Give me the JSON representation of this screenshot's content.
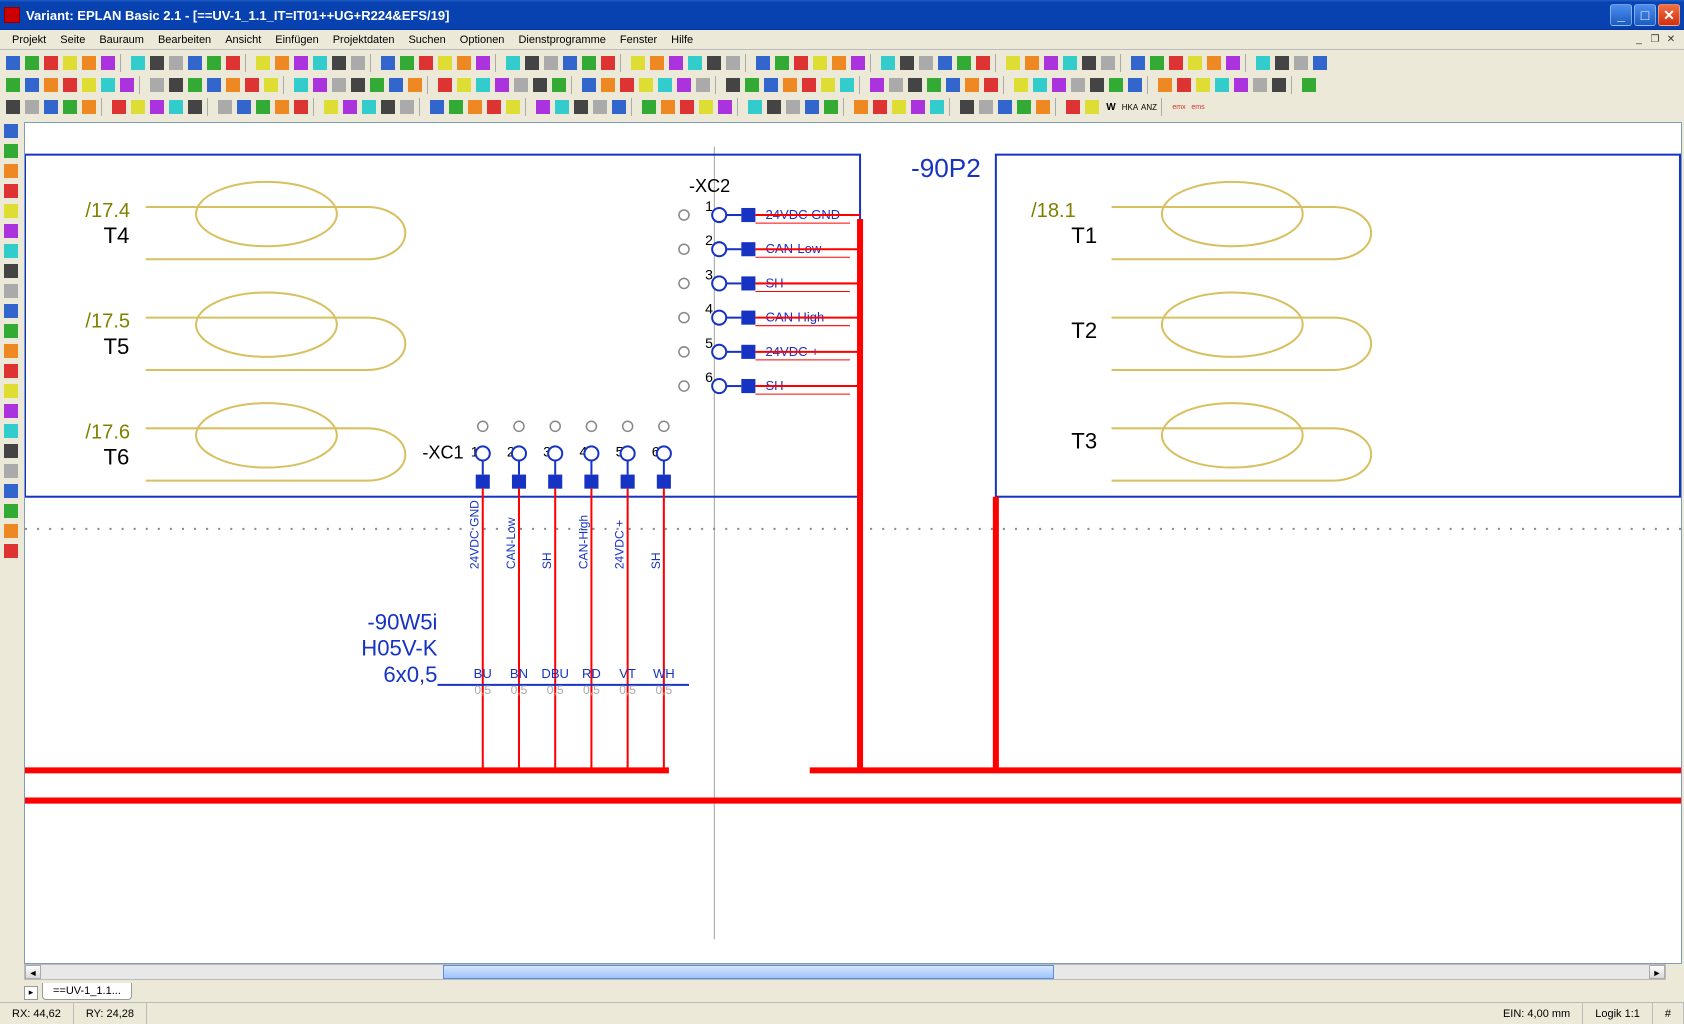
{
  "app": {
    "title": "Variant:  EPLAN Basic 2.1 - [==UV-1_1.1_IT=IT01++UG+R224&EFS/19]"
  },
  "menu": {
    "items": [
      "Projekt",
      "Seite",
      "Bauraum",
      "Bearbeiten",
      "Ansicht",
      "Einfügen",
      "Projektdaten",
      "Suchen",
      "Optionen",
      "Dienstprogramme",
      "Fenster",
      "Hilfe"
    ]
  },
  "schematic": {
    "part90P2": "-90P2",
    "connXC2": "-XC2",
    "connXC1": "-XC1",
    "xc2_pins": [
      "1",
      "2",
      "3",
      "4",
      "5",
      "6"
    ],
    "xc2_signals": [
      "24VDC GND",
      "CAN-Low",
      "SH",
      "CAN-High",
      "24VDC +",
      "SH"
    ],
    "xc1_pins": [
      "1",
      "2",
      "3",
      "4",
      "5",
      "6"
    ],
    "xc1_signals": [
      "24VDC GND",
      "CAN-Low",
      "SH",
      "CAN-High",
      "24VDC +",
      "SH"
    ],
    "leftrefs": [
      {
        "page": "/17.4",
        "term": "T4"
      },
      {
        "page": "/17.5",
        "term": "T5"
      },
      {
        "page": "/17.6",
        "term": "T6"
      }
    ],
    "rightrefs": [
      {
        "page": "/18.1",
        "term": "T1"
      },
      {
        "page": "",
        "term": "T2"
      },
      {
        "page": "",
        "term": "T3"
      }
    ],
    "cable": {
      "name": "-90W5i",
      "type": "H05V-K",
      "spec": "6x0,5"
    },
    "cores": [
      {
        "color": "BU",
        "cs": "0,5"
      },
      {
        "color": "BN",
        "cs": "0,5"
      },
      {
        "color": "DBU",
        "cs": "0,5"
      },
      {
        "color": "RD",
        "cs": "0,5"
      },
      {
        "color": "VT",
        "cs": "0,5"
      },
      {
        "color": "WH",
        "cs": "0,5"
      }
    ]
  },
  "doctab": {
    "label": "==UV-1_1.1..."
  },
  "status": {
    "rx": "RX: 44,62",
    "ry": "RY: 24,28",
    "ein": "EIN: 4,00 mm",
    "logik": "Logik 1:1",
    "hash": "#"
  }
}
